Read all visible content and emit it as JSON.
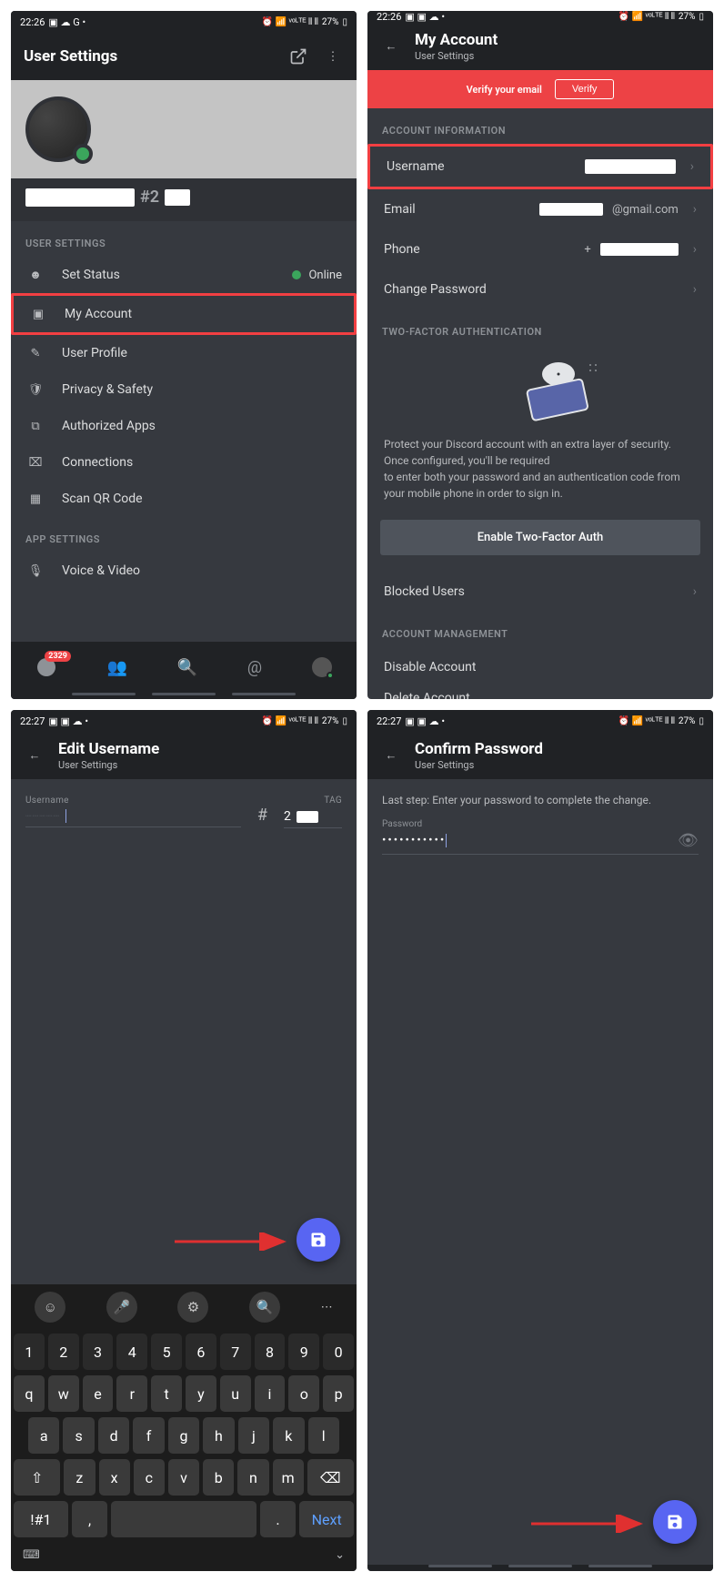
{
  "statusbar1": {
    "time": "22:26",
    "battery": "27%"
  },
  "statusbar2": {
    "time": "22:26",
    "battery": "27%"
  },
  "statusbar3": {
    "time": "22:27",
    "battery": "27%"
  },
  "statusbar4": {
    "time": "22:27",
    "battery": "27%"
  },
  "screen1": {
    "title": "User Settings",
    "tag_separator": "#2",
    "section_user": "USER SETTINGS",
    "section_app": "APP SETTINGS",
    "items": {
      "set_status": "Set Status",
      "status_value": "Online",
      "my_account": "My Account",
      "user_profile": "User Profile",
      "privacy": "Privacy & Safety",
      "authorized": "Authorized Apps",
      "connections": "Connections",
      "scan_qr": "Scan QR Code",
      "voice_video": "Voice & Video"
    },
    "badge": "2329"
  },
  "screen2": {
    "title": "My Account",
    "subtitle": "User Settings",
    "verify_text": "Verify your email",
    "verify_btn": "Verify",
    "section_account_info": "ACCOUNT INFORMATION",
    "rows": {
      "username_label": "Username",
      "email_label": "Email",
      "email_suffix": "@gmail.com",
      "phone_label": "Phone",
      "phone_prefix": "+",
      "change_password": "Change Password"
    },
    "section_2fa": "TWO-FACTOR AUTHENTICATION",
    "twofa_desc1": "Protect your Discord account with an extra layer of security. Once configured, you'll be required",
    "twofa_desc2": "to enter both your password and an authentication code from your mobile phone in order to sign in.",
    "enable_2fa": "Enable Two-Factor Auth",
    "blocked_users": "Blocked Users",
    "section_mgmt": "ACCOUNT MANAGEMENT",
    "disable": "Disable Account",
    "delete": "Delete Account"
  },
  "screen3": {
    "title": "Edit Username",
    "subtitle": "User Settings",
    "username_label": "Username",
    "tag_label": "TAG",
    "tag_sep": "#",
    "tag_value": "2",
    "keyboard": {
      "row_num": [
        "1",
        "2",
        "3",
        "4",
        "5",
        "6",
        "7",
        "8",
        "9",
        "0"
      ],
      "row1": [
        "q",
        "w",
        "e",
        "r",
        "t",
        "y",
        "u",
        "i",
        "o",
        "p"
      ],
      "row2": [
        "a",
        "s",
        "d",
        "f",
        "g",
        "h",
        "j",
        "k",
        "l"
      ],
      "row3": [
        "⇧",
        "z",
        "x",
        "c",
        "v",
        "b",
        "n",
        "m",
        "⌫"
      ],
      "sym": "!#1",
      "comma": ",",
      "period": ".",
      "next": "Next"
    }
  },
  "screen4": {
    "title": "Confirm Password",
    "subtitle": "User Settings",
    "instruction": "Last step: Enter your password to complete the change.",
    "password_label": "Password",
    "password_dots": "•••••••••••"
  }
}
